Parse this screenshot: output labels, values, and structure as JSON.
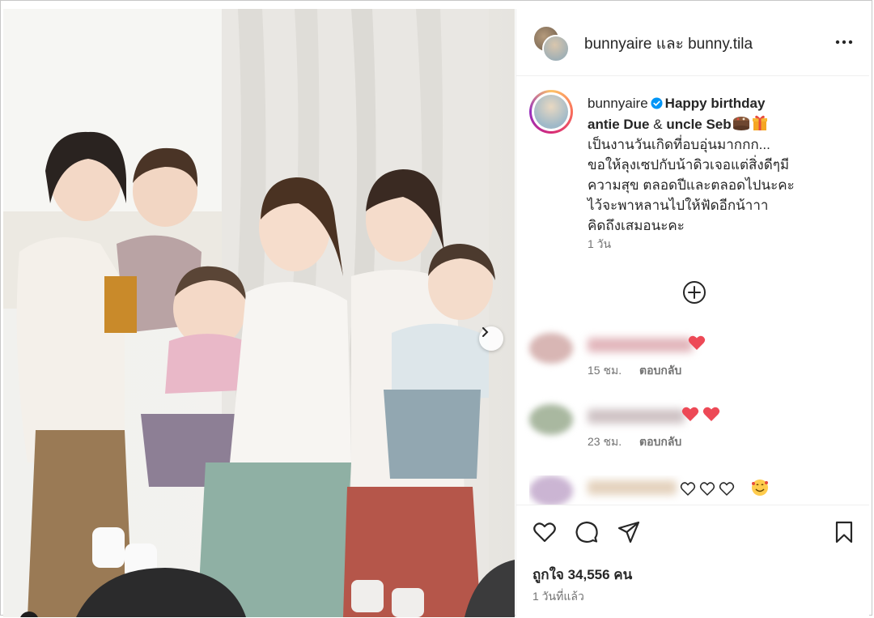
{
  "header": {
    "names": "bunnyaire และ bunny.tila",
    "more_icon": "more-horizontal-icon"
  },
  "caption": {
    "username": "bunnyaire",
    "line1_bold": "Happy birthday",
    "line2_bold_a": "antie Due",
    "line2_amp": "&",
    "line2_bold_b": "uncle Seb",
    "lines": [
      "เป็นงานวันเกิดที่อบอุ่นมากกก...",
      "ขอให้ลุงเซปกับน้าดิวเจอแต่สิ่งดีๆมี",
      "ความสุข ตลอดปีและตลอดไปนะคะ",
      "ไว้จะพาหลานไปให้ฟัดอีกน้าาา",
      "คิดถึงเสมอนะคะ"
    ],
    "time": "1 วัน"
  },
  "comments": [
    {
      "time": "15 ชม.",
      "reply": "ตอบกลับ"
    },
    {
      "time": "23 ชม.",
      "reply": "ตอบกลับ"
    },
    {
      "time": "",
      "reply": ""
    }
  ],
  "likes": "ถูกใจ 34,556 คน",
  "post_time": "1 วันที่แล้ว",
  "colors": {
    "heart": "#ed4956",
    "verified": "#0095f6",
    "muted": "#737373",
    "text": "#262626"
  }
}
